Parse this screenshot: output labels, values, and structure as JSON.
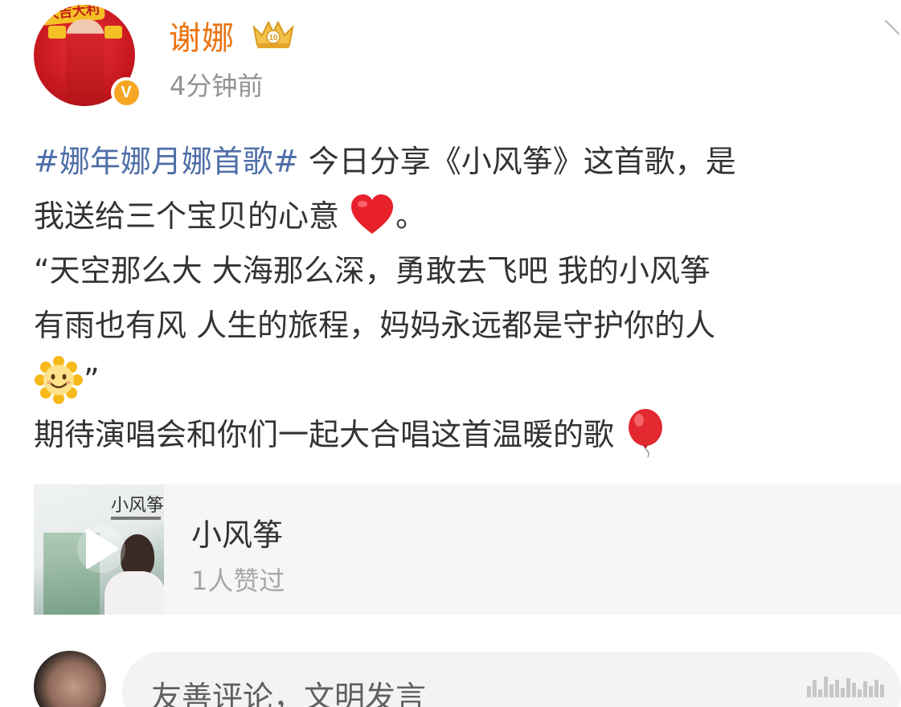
{
  "author": {
    "name": "谢娜",
    "time": "4分钟前",
    "avatar_banner": "大吉大利",
    "verified_label": "V",
    "crown_level": "10"
  },
  "post": {
    "hashtag": "#娜年娜月娜首歌#",
    "line1_rest": " 今日分享《小风筝》这首歌，是",
    "line2": "我送给三个宝贝的心意",
    "line2_end": "。",
    "line3": "“天空那么大 大海那么深，勇敢去飞吧 我的小风筝",
    "line4": "有雨也有风 人生的旅程，妈妈永远都是守护你的人",
    "line5_end": "”",
    "line6": "期待演唱会和你们一起大合唱这首温暖的歌",
    "emojis": [
      "heart-emoji",
      "sun-face-emoji",
      "balloon-emoji"
    ]
  },
  "music_card": {
    "title": "小风筝",
    "likes": "1人赞过",
    "album_title": "小风筝"
  },
  "comment": {
    "placeholder": "友善评论，文明发言"
  },
  "colors": {
    "username": "#eb7310",
    "hashtag": "#4e6ea7",
    "verify_badge": "#f6a623",
    "body_text": "#333333",
    "muted_text": "#939393"
  }
}
